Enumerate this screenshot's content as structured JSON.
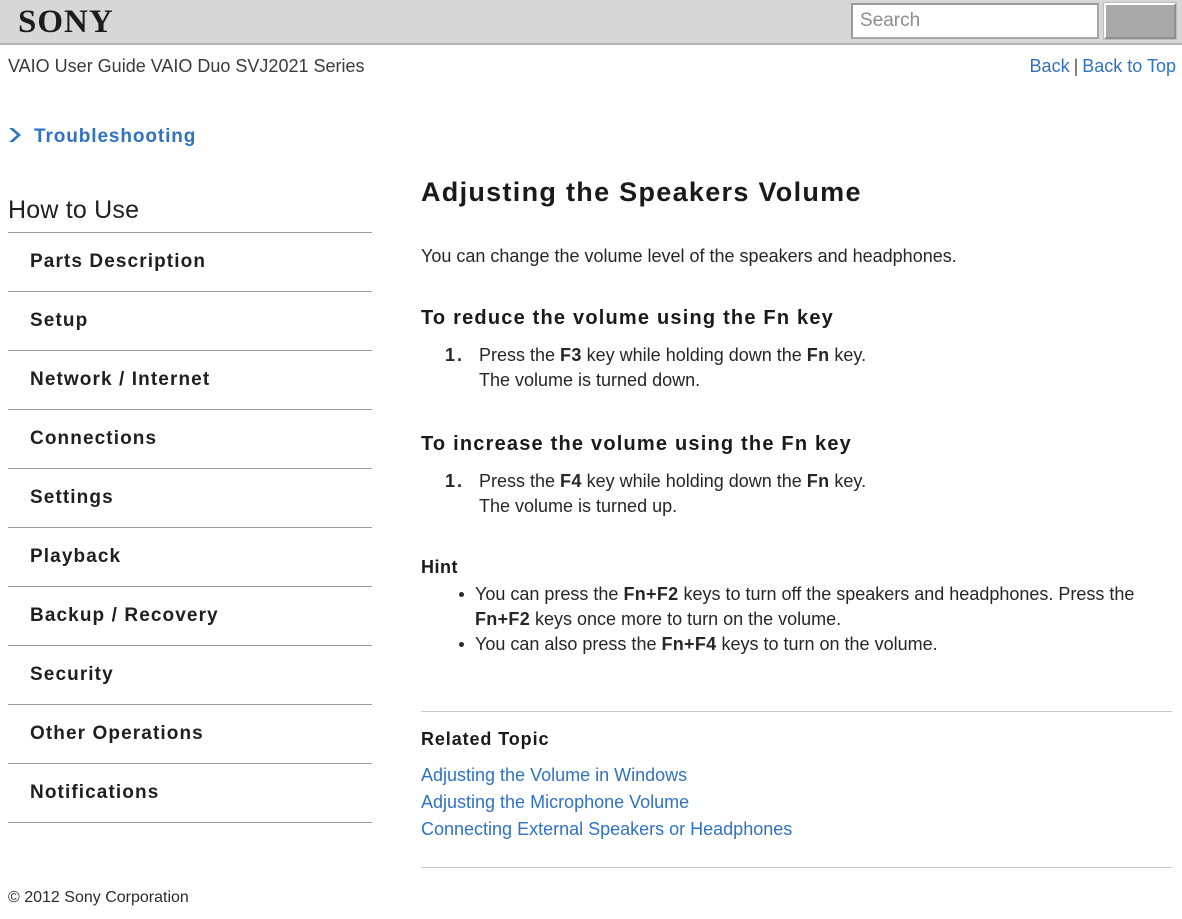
{
  "header": {
    "logo_text": "SONY",
    "search": {
      "placeholder": "Search",
      "value": "",
      "button_label": ""
    }
  },
  "title_row": {
    "guide_title": "VAIO User Guide VAIO Duo SVJ2021 Series",
    "back_label": "Back",
    "separator": "|",
    "back_to_top_label": "Back to Top"
  },
  "sidebar": {
    "troubleshooting_label": "Troubleshooting",
    "section_heading": "How to Use",
    "items": [
      {
        "label": "Parts Description"
      },
      {
        "label": "Setup"
      },
      {
        "label": "Network / Internet"
      },
      {
        "label": "Connections"
      },
      {
        "label": "Settings"
      },
      {
        "label": "Playback"
      },
      {
        "label": "Backup / Recovery"
      },
      {
        "label": "Security"
      },
      {
        "label": "Other Operations"
      },
      {
        "label": "Notifications"
      }
    ]
  },
  "main": {
    "page_heading": "Adjusting the Speakers Volume",
    "intro": "You can change the volume level of the speakers and headphones.",
    "reduce": {
      "heading": "To reduce the volume using the Fn key",
      "step_number": "1.",
      "step_before": "Press the ",
      "step_key1": "F3",
      "step_middle": " key while holding down the ",
      "step_key2": "Fn",
      "step_after": " key.",
      "result": "The volume is turned down."
    },
    "increase": {
      "heading": "To increase the volume using the Fn key",
      "step_number": "1.",
      "step_before": "Press the ",
      "step_key1": "F4",
      "step_middle": " key while holding down the ",
      "step_key2": "Fn",
      "step_after": " key.",
      "result": "The volume is turned up."
    },
    "hint": {
      "heading": "Hint",
      "item1_before": "You can press the ",
      "item1_key1": "Fn+F2",
      "item1_middle": " keys to turn off the speakers and headphones. Press the ",
      "item1_key2": "Fn+F2",
      "item1_after": " keys once more to turn on the volume.",
      "item2_before": "You can also press the ",
      "item2_key1": "Fn+F4",
      "item2_after": " keys to turn on the volume."
    },
    "related": {
      "heading": "Related Topic",
      "links": [
        {
          "label": "Adjusting the Volume in Windows"
        },
        {
          "label": "Adjusting the Microphone Volume"
        },
        {
          "label": "Connecting External Speakers or Headphones"
        }
      ]
    }
  },
  "footer": {
    "copyright": "© 2012 Sony Corporation"
  },
  "colors": {
    "link_blue": "#2f72c4",
    "header_gray": "#d7d7d7",
    "divider_gray": "#9a9a9a",
    "text": "#262626"
  }
}
